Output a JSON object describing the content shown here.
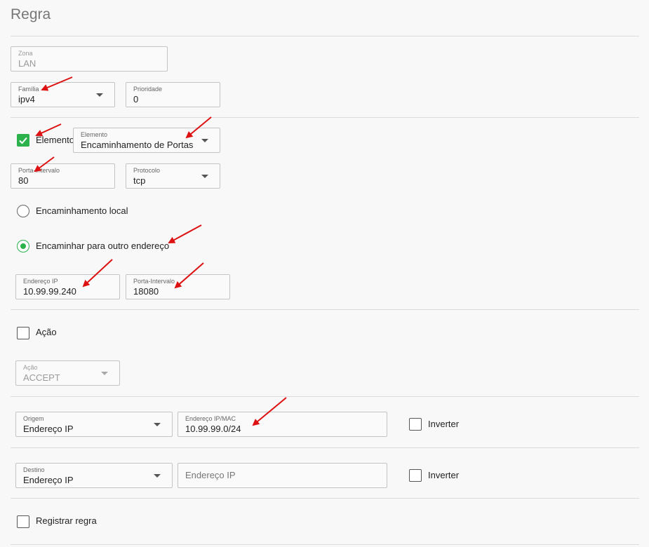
{
  "page": {
    "title": "Regra"
  },
  "zona": {
    "label": "Zona",
    "value": "LAN"
  },
  "familia": {
    "label": "Família",
    "value": "ipv4"
  },
  "prioridade": {
    "label": "Prioridade",
    "value": "0"
  },
  "elemento": {
    "checkbox_label": "Elemento",
    "label": "Elemento",
    "value": "Encaminhamento de Portas",
    "checked": true
  },
  "porta_intervalo": {
    "label": "Porta-Intervalo",
    "value": "80"
  },
  "protocolo": {
    "label": "Protocolo",
    "value": "tcp"
  },
  "encaminhamento_local": {
    "label": "Encaminhamento local",
    "selected": false
  },
  "encaminhar_outro": {
    "label": "Encaminhar para outro endereço",
    "selected": true
  },
  "endereco_ip": {
    "label": "Endereço IP",
    "value": "10.99.99.240"
  },
  "porta_destino": {
    "label": "Porta-Intervalo",
    "value": "18080"
  },
  "acao": {
    "checkbox_label": "Ação",
    "label": "Ação",
    "value": "ACCEPT",
    "checked": false
  },
  "origem": {
    "label": "Origem",
    "value": "Endereço IP",
    "addr_label": "Endereço IP/MAC",
    "addr_value": "10.99.99.0/24",
    "invert_label": "Inverter"
  },
  "destino": {
    "label": "Destino",
    "value": "Endereço IP",
    "addr_placeholder": "Endereço IP",
    "invert_label": "Inverter"
  },
  "registrar": {
    "label": "Registrar regra",
    "checked": false
  },
  "colors": {
    "accent": "#2bb24c",
    "annotation": "#dd1111"
  }
}
